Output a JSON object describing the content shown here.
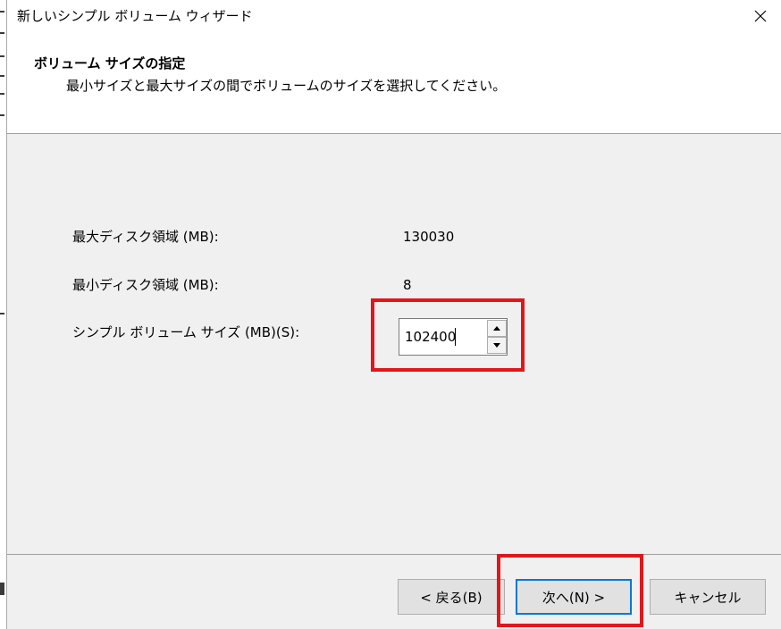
{
  "window": {
    "title": "新しいシンプル ボリューム ウィザード",
    "close_icon": "close-icon"
  },
  "header": {
    "title": "ボリューム サイズの指定",
    "subtitle": "最小サイズと最大サイズの間でボリュームのサイズを選択してください。"
  },
  "fields": {
    "max_disk_label": "最大ディスク領域 (MB):",
    "max_disk_value": "130030",
    "min_disk_label": "最小ディスク領域 (MB):",
    "min_disk_value": "8",
    "volume_size_label": "シンプル ボリューム サイズ (MB)(S):",
    "volume_size_value": "102400"
  },
  "buttons": {
    "back_label": "< 戻る(B)",
    "next_label": "次へ(N) >",
    "cancel_label": "キャンセル"
  },
  "colors": {
    "highlight": "#e2161b",
    "default_button_border": "#0078d7",
    "dialog_background": "#f0f0f0",
    "button_face": "#e1e1e1"
  }
}
